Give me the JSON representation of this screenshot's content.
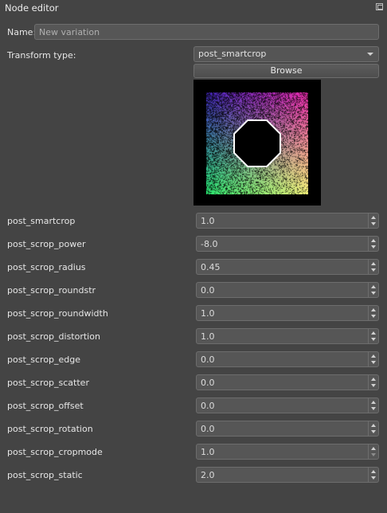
{
  "panel": {
    "title": "Node editor",
    "undock_icon": "undock-icon"
  },
  "name": {
    "label": "Name:",
    "placeholder": "New variation",
    "value": ""
  },
  "transform": {
    "label": "Transform type:",
    "selected": "post_smartcrop",
    "browse_label": "Browse"
  },
  "preview": {
    "description_icon": "variation-preview"
  },
  "params": [
    {
      "label": "post_smartcrop",
      "value": "1.0"
    },
    {
      "label": "post_scrop_power",
      "value": "-8.0"
    },
    {
      "label": "post_scrop_radius",
      "value": "0.45"
    },
    {
      "label": "post_scrop_roundstr",
      "value": "0.0"
    },
    {
      "label": "post_scrop_roundwidth",
      "value": "1.0"
    },
    {
      "label": "post_scrop_distortion",
      "value": "1.0"
    },
    {
      "label": "post_scrop_edge",
      "value": "0.0"
    },
    {
      "label": "post_scrop_scatter",
      "value": "0.0"
    },
    {
      "label": "post_scrop_offset",
      "value": "0.0"
    },
    {
      "label": "post_scrop_rotation",
      "value": "0.0"
    },
    {
      "label": "post_scrop_cropmode",
      "value": "1.0"
    },
    {
      "label": "post_scrop_static",
      "value": "2.0"
    }
  ]
}
